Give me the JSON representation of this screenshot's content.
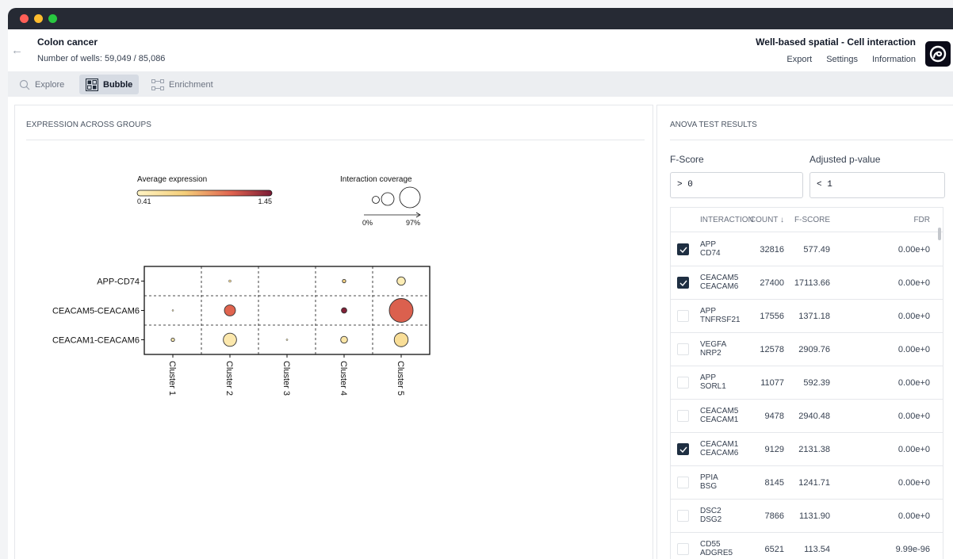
{
  "window": {
    "title": ""
  },
  "header": {
    "project_title": "Colon cancer",
    "wells_text": "Number of wells: 59,049 / 85,086",
    "mode_title": "Well-based spatial - Cell interaction",
    "menu": [
      "Export",
      "Settings",
      "Information"
    ]
  },
  "toolbar": {
    "explore": "Explore",
    "bubble": "Bubble",
    "enrichment": "Enrichment"
  },
  "left_panel": {
    "title": "EXPRESSION ACROSS GROUPS"
  },
  "chart_data": {
    "type": "bubble",
    "legend_color": {
      "title": "Average expression",
      "min": 0.41,
      "max": 1.45,
      "min_label": "0.41",
      "max_label": "1.45",
      "colors": [
        "#fff4c4",
        "#f5cf7a",
        "#e0634f",
        "#7a1b35"
      ]
    },
    "legend_size": {
      "title": "Interaction coverage",
      "min_label": "0%",
      "max_label": "97%"
    },
    "rows": [
      "APP-CD74",
      "CEACAM5-CEACAM6",
      "CEACAM1-CEACAM6"
    ],
    "columns": [
      "Cluster 1",
      "Cluster 2",
      "Cluster 3",
      "Cluster 4",
      "Cluster 5"
    ],
    "points": [
      {
        "row": "APP-CD74",
        "col": "Cluster 2",
        "coverage": 1,
        "expression": 0.6
      },
      {
        "row": "APP-CD74",
        "col": "Cluster 4",
        "coverage": 2,
        "expression": 0.7
      },
      {
        "row": "APP-CD74",
        "col": "Cluster 5",
        "coverage": 12,
        "expression": 0.48
      },
      {
        "row": "CEACAM5-CEACAM6",
        "col": "Cluster 1",
        "coverage": 0.3,
        "expression": 0.45
      },
      {
        "row": "CEACAM5-CEACAM6",
        "col": "Cluster 2",
        "coverage": 21,
        "expression": 1.1
      },
      {
        "row": "CEACAM5-CEACAM6",
        "col": "Cluster 4",
        "coverage": 5,
        "expression": 1.42
      },
      {
        "row": "CEACAM5-CEACAM6",
        "col": "Cluster 5",
        "coverage": 97,
        "expression": 1.12
      },
      {
        "row": "CEACAM1-CEACAM6",
        "col": "Cluster 1",
        "coverage": 2,
        "expression": 0.5
      },
      {
        "row": "CEACAM1-CEACAM6",
        "col": "Cluster 2",
        "coverage": 30,
        "expression": 0.52
      },
      {
        "row": "CEACAM1-CEACAM6",
        "col": "Cluster 3",
        "coverage": 0.5,
        "expression": 0.45
      },
      {
        "row": "CEACAM1-CEACAM6",
        "col": "Cluster 4",
        "coverage": 8,
        "expression": 0.55
      },
      {
        "row": "CEACAM1-CEACAM6",
        "col": "Cluster 5",
        "coverage": 33,
        "expression": 0.62
      }
    ],
    "grid": "dashed"
  },
  "right_panel": {
    "title": "ANOVA TEST RESULTS",
    "fscore_label": "F-Score",
    "fscore_value": "> 0",
    "pvalue_label": "Adjusted p-value",
    "pvalue_value": "< 1",
    "columns": {
      "interaction": "INTERACTION",
      "count": "COUNT ↓",
      "fscore": "F-SCORE",
      "fdr": "FDR"
    },
    "rows": [
      {
        "a": "APP",
        "b": "CD74",
        "count": "32816",
        "fscore": "577.49",
        "fdr": "0.00e+0",
        "checked": true
      },
      {
        "a": "CEACAM5",
        "b": "CEACAM6",
        "count": "27400",
        "fscore": "17113.66",
        "fdr": "0.00e+0",
        "checked": true
      },
      {
        "a": "APP",
        "b": "TNFRSF21",
        "count": "17556",
        "fscore": "1371.18",
        "fdr": "0.00e+0",
        "checked": false
      },
      {
        "a": "VEGFA",
        "b": "NRP2",
        "count": "12578",
        "fscore": "2909.76",
        "fdr": "0.00e+0",
        "checked": false
      },
      {
        "a": "APP",
        "b": "SORL1",
        "count": "11077",
        "fscore": "592.39",
        "fdr": "0.00e+0",
        "checked": false
      },
      {
        "a": "CEACAM5",
        "b": "CEACAM1",
        "count": "9478",
        "fscore": "2940.48",
        "fdr": "0.00e+0",
        "checked": false
      },
      {
        "a": "CEACAM1",
        "b": "CEACAM6",
        "count": "9129",
        "fscore": "2131.38",
        "fdr": "0.00e+0",
        "checked": true
      },
      {
        "a": "PPIA",
        "b": "BSG",
        "count": "8145",
        "fscore": "1241.71",
        "fdr": "0.00e+0",
        "checked": false
      },
      {
        "a": "DSC2",
        "b": "DSG2",
        "count": "7866",
        "fscore": "1131.90",
        "fdr": "0.00e+0",
        "checked": false
      },
      {
        "a": "CD55",
        "b": "ADGRE5",
        "count": "6521",
        "fscore": "113.54",
        "fdr": "9.99e-96",
        "checked": false
      }
    ]
  }
}
